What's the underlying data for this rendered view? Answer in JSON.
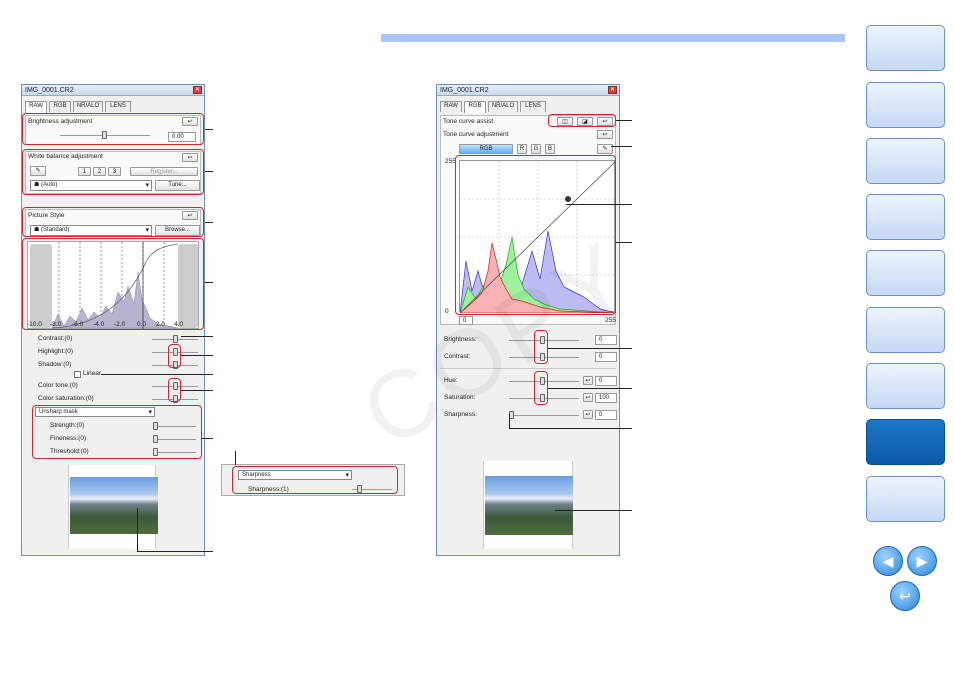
{
  "left_window": {
    "title": "IMG_0001.CR2",
    "tabs": [
      "RAW",
      "RGB",
      "NR/ALO",
      "LENS"
    ],
    "brightness": {
      "label": "Brightness adjustment",
      "value": "0.00"
    },
    "white_balance": {
      "label": "White balance adjustment",
      "presets": [
        "1",
        "2",
        "3"
      ],
      "register": "Register...",
      "mode": "(Auto)",
      "tune": "Tune..."
    },
    "picture_style": {
      "label": "Picture Style",
      "value": "(Standard)",
      "browse": "Browse..."
    },
    "axis": [
      "-10.0",
      "-8.0",
      "-6.0",
      "-4.0",
      "-2.0",
      "0.0",
      "2.0",
      "4.0"
    ],
    "sliders": [
      "Contrast:(0)",
      "Highlight:(0)",
      "Shadow:(0)",
      "Color tone:(0)",
      "Color saturation:(0)"
    ],
    "linear": "Linear",
    "unsharp": {
      "mode": "Unsharp mask",
      "items": [
        "Strength:(0)",
        "Fineness:(0)",
        "Threshold:(0)"
      ]
    },
    "sharpness_inset": {
      "mode": "Sharpness",
      "item": "Sharpness:(1)"
    }
  },
  "right_window": {
    "title": "IMG_0001.CR2",
    "tabs": [
      "RAW",
      "RGB",
      "NR/ALO",
      "LENS"
    ],
    "tone_assist": "Tone curve assist",
    "tone_adjust": "Tone curve adjustment",
    "channels": [
      "RGB",
      "R",
      "G",
      "B"
    ],
    "graph_top": "255",
    "graph_bottom": "0",
    "in_min": "0",
    "in_max": "255",
    "rows": [
      {
        "label": "Brightness:",
        "value": "0"
      },
      {
        "label": "Contrast:",
        "value": "0"
      },
      {
        "label": "Hue:",
        "value": "0"
      },
      {
        "label": "Saturation:",
        "value": "100"
      },
      {
        "label": "Sharpness:",
        "value": "0"
      }
    ]
  },
  "watermark": "COPY",
  "nav_active_index": 7
}
